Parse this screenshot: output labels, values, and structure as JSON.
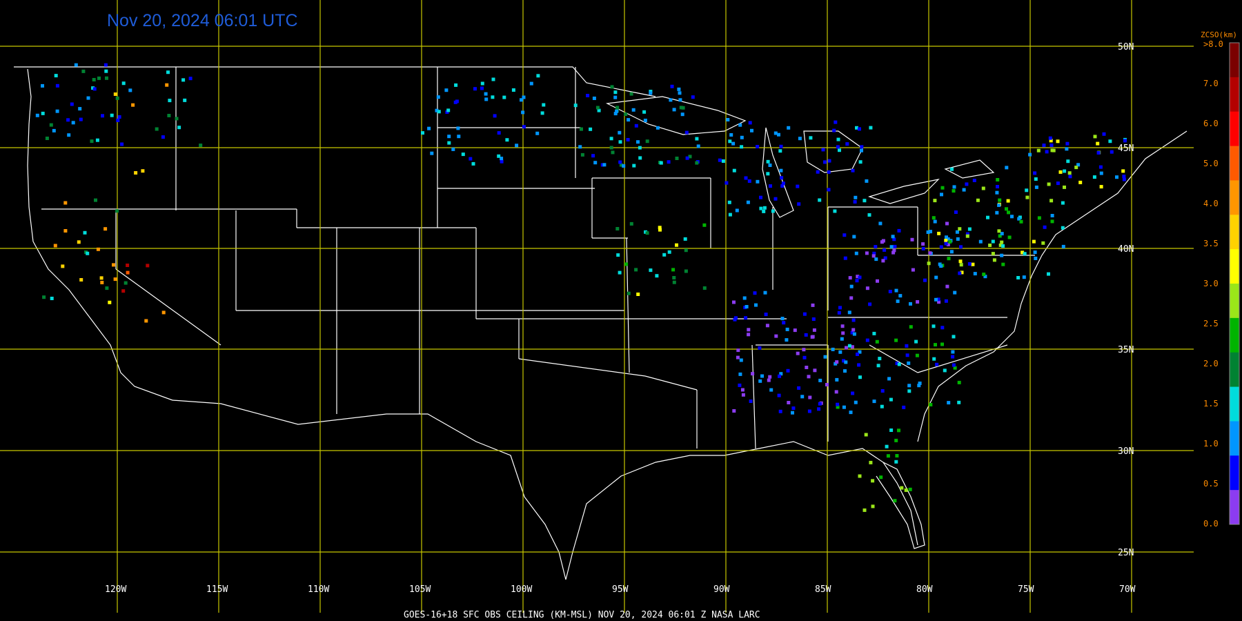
{
  "title": "Nov 20, 2024 06:01 UTC",
  "footer": "GOES-16+18  SFC OBS CEILING (KM-MSL)   NOV 20, 2024 06:01 Z   NASA LARC",
  "grid_color": "#c8c800",
  "border_color": "#ffffff",
  "longitude_labels": [
    "120W",
    "115W",
    "110W",
    "105W",
    "100W",
    "95W",
    "90W",
    "85W",
    "80W",
    "75W",
    "70W"
  ],
  "latitude_labels": [
    "50N",
    "45N",
    "40N",
    "35N",
    "30N",
    "25N"
  ],
  "legend": {
    "title": "ZCSO(km)",
    "top_label": ">8.0",
    "labels": [
      "7.0",
      "6.0",
      "5.0",
      "4.0",
      "3.5",
      "3.0",
      "2.5",
      "2.0",
      "1.5",
      "1.0",
      "0.5",
      "0.0"
    ],
    "colors": [
      "#7b0000",
      "#b40000",
      "#ff0000",
      "#ff5a00",
      "#ff9600",
      "#ffd200",
      "#ffff00",
      "#9be619",
      "#00b400",
      "#008232",
      "#00dcdc",
      "#0096ff",
      "#0000ff",
      "#8c3cf0"
    ]
  },
  "obs_colors": {
    "purple": "#8c3cf0",
    "blue": "#0000ff",
    "ltblue": "#0096ff",
    "cyan": "#00dcdc",
    "dkgreen": "#008232",
    "green": "#00b400",
    "ltgreen": "#9be619",
    "yellow": "#ffff00",
    "gold": "#ffd200",
    "orange": "#ff9600",
    "dkorange": "#ff5a00",
    "red": "#ff0000",
    "dkred": "#b40000"
  }
}
